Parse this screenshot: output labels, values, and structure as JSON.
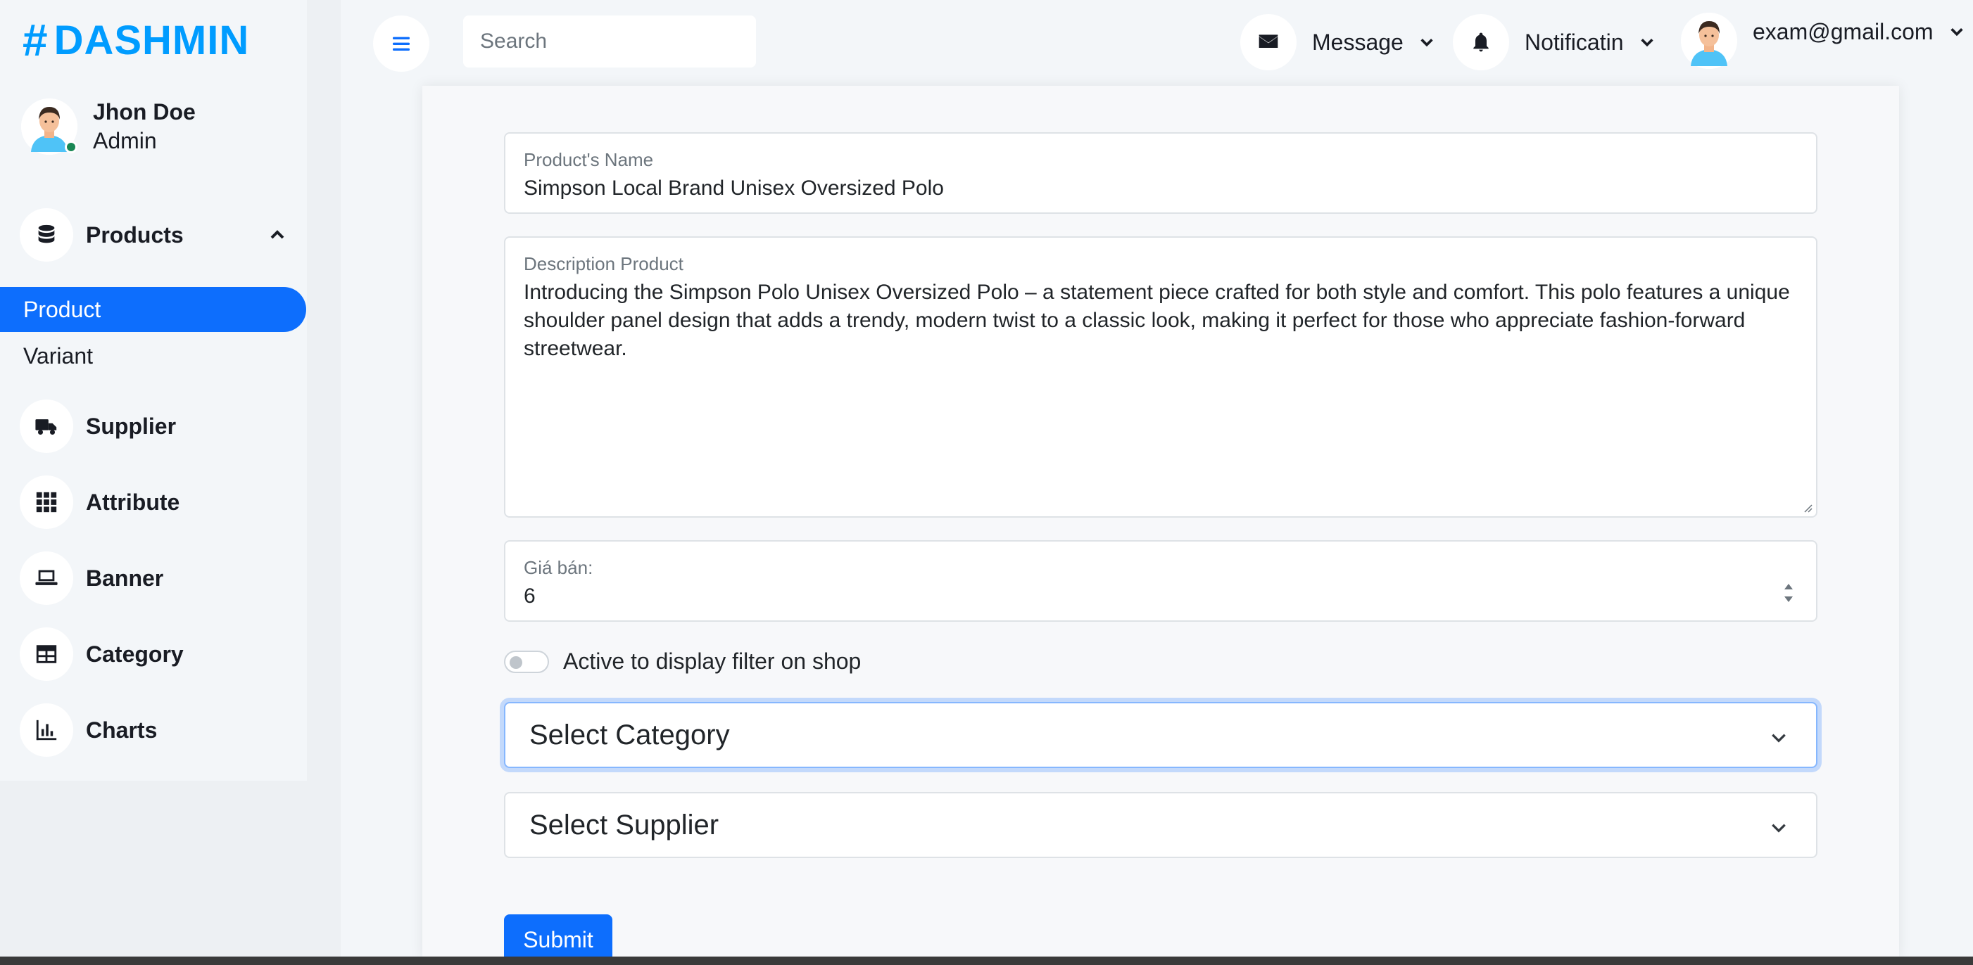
{
  "brand": {
    "hash": "#",
    "name": "DASHMIN"
  },
  "user": {
    "name": "Jhon Doe",
    "role": "Admin"
  },
  "sidebar": {
    "items": [
      {
        "label": "Products",
        "icon": "database-icon"
      },
      {
        "label": "Supplier",
        "icon": "truck-icon"
      },
      {
        "label": "Attribute",
        "icon": "grid-icon"
      },
      {
        "label": "Banner",
        "icon": "laptop-icon"
      },
      {
        "label": "Category",
        "icon": "table-icon"
      },
      {
        "label": "Charts",
        "icon": "chart-icon"
      }
    ],
    "submenu": [
      {
        "label": "Product",
        "active": true
      },
      {
        "label": "Variant",
        "active": false
      }
    ]
  },
  "topbar": {
    "search_placeholder": "Search",
    "message_label": "Message",
    "notification_label": "Notificatin",
    "account_label": "exam@gmail.com"
  },
  "form": {
    "name_label": "Product's Name",
    "name_value": "Simpson Local Brand Unisex Oversized Polo",
    "description_label": "Description Product",
    "description_value": "Introducing the Simpson Polo Unisex Oversized Polo – a statement piece crafted for both style and comfort. This polo features a unique shoulder panel design that adds a trendy, modern twist to a classic look, making it perfect for those who appreciate fashion-forward streetwear.",
    "price_label": "Giá bán:",
    "price_value": "6",
    "active_label": "Active to display filter on shop",
    "category_select": "Select Category",
    "supplier_select": "Select Supplier",
    "submit_label": "Submit"
  },
  "colors": {
    "brand": "#009cff",
    "primary": "#0d6efd",
    "online": "#198754"
  }
}
